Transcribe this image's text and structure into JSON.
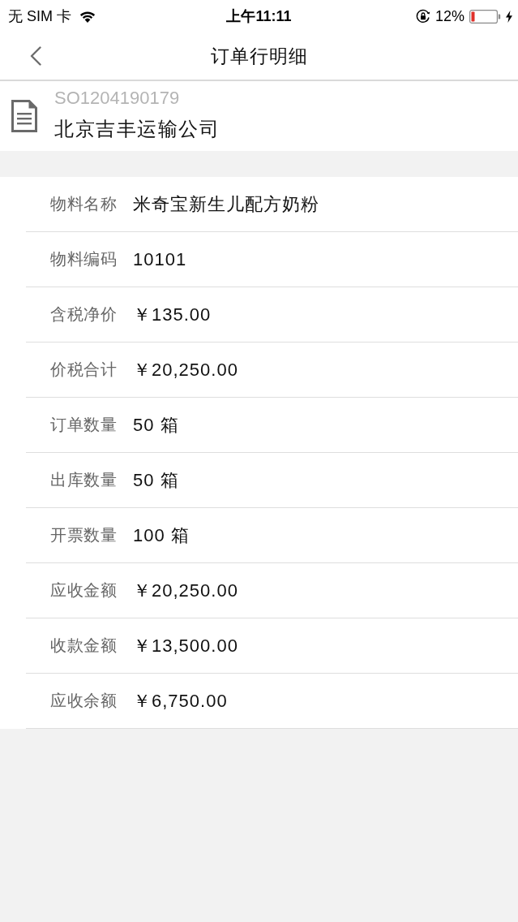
{
  "status_bar": {
    "carrier": "无 SIM 卡",
    "time": "上午11:11",
    "battery": "12%"
  },
  "nav_bar": {
    "title": "订单行明细"
  },
  "order": {
    "number": "SO1204190179",
    "customer": "北京吉丰运输公司"
  },
  "details": [
    {
      "label": "物料名称",
      "value": "米奇宝新生儿配方奶粉"
    },
    {
      "label": "物料编码",
      "value": "10101"
    },
    {
      "label": "含税净价",
      "value": "￥135.00"
    },
    {
      "label": "价税合计",
      "value": "￥20,250.00"
    },
    {
      "label": "订单数量",
      "value": "50 箱"
    },
    {
      "label": "出库数量",
      "value": "50 箱"
    },
    {
      "label": "开票数量",
      "value": "100 箱"
    },
    {
      "label": "应收金额",
      "value": "￥20,250.00"
    },
    {
      "label": "收款金额",
      "value": "￥13,500.00"
    },
    {
      "label": "应收余额",
      "value": "￥6,750.00"
    }
  ]
}
